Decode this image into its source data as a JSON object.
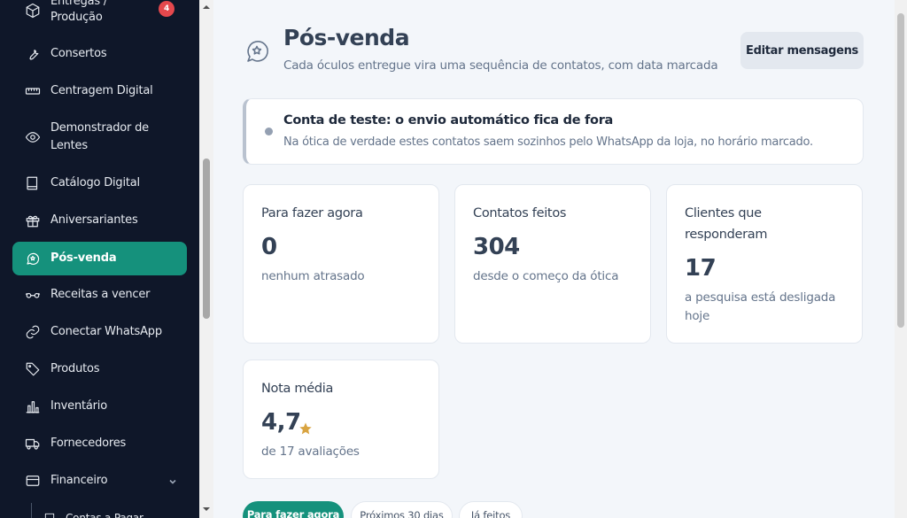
{
  "sidebar": {
    "items": [
      {
        "label_line1": "Entregas /",
        "label_line2": "Produção",
        "icon": "package-icon",
        "badge": "4"
      },
      {
        "label": "Consertos",
        "icon": "wrench-icon"
      },
      {
        "label": "Centragem Digital",
        "icon": "ruler-icon"
      },
      {
        "label_line1": "Demonstrador de",
        "label_line2": "Lentes",
        "icon": "eye-icon"
      },
      {
        "label": "Catálogo Digital",
        "icon": "book-icon"
      },
      {
        "label": "Aniversariantes",
        "icon": "gift-icon"
      },
      {
        "label": "Pós-venda",
        "icon": "message-star-icon",
        "active": true
      },
      {
        "label": "Receitas a vencer",
        "icon": "glasses-icon"
      },
      {
        "label": "Conectar WhatsApp",
        "icon": "link-icon"
      },
      {
        "label": "Produtos",
        "icon": "tag-icon"
      },
      {
        "label": "Inventário",
        "icon": "bar-chart-icon"
      },
      {
        "label": "Fornecedores",
        "icon": "truck-icon"
      },
      {
        "label": "Financeiro",
        "icon": "wallet-icon"
      },
      {
        "label": "Contas a Pagar",
        "icon": "receipt-icon"
      }
    ]
  },
  "header": {
    "title": "Pós-venda",
    "subtitle": "Cada óculos entregue vira uma sequência de contatos, com data marcada",
    "edit_button": "Editar mensagens"
  },
  "notice": {
    "title": "Conta de teste: o envio automático fica de fora",
    "text": "Na ótica de verdade estes contatos saem sozinhos pelo WhatsApp da loja, no horário marcado."
  },
  "cards": [
    {
      "label": "Para fazer agora",
      "value": "0",
      "note": "nenhum atrasado"
    },
    {
      "label": "Contatos feitos",
      "value": "304",
      "note": "desde o começo da ótica"
    },
    {
      "label": "Clientes que responderam",
      "value": "17",
      "note": "a pesquisa está desligada hoje"
    },
    {
      "label": "Nota média",
      "value": "4,7",
      "note": "de 17 avaliações"
    }
  ],
  "tabs": [
    {
      "label": "Para fazer agora",
      "active": true
    },
    {
      "label": "Próximos 30 dias"
    },
    {
      "label": "Já feitos"
    }
  ],
  "colors": {
    "sidebar_bg": "#0f1729",
    "accent": "#15917c",
    "badge": "#e5484d",
    "star": "#d9a441"
  }
}
